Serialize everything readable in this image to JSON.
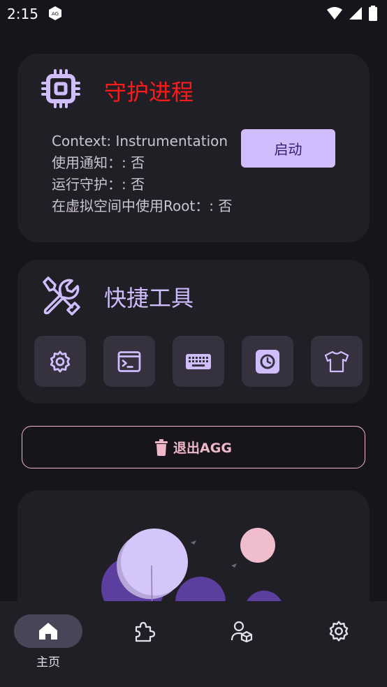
{
  "status_bar": {
    "time": "2:15"
  },
  "guard_card": {
    "title": "守护进程",
    "title_color": "#ff1a1a",
    "context_line": "Context: Instrumentation",
    "notify_line": "使用通知：: 否",
    "guard_line": "运行守护：: 否",
    "root_line": "在虚拟空间中使用Root：: 否",
    "start_button": "启动",
    "icon": "cpu-icon"
  },
  "tools_card": {
    "title": "快捷工具",
    "icon": "wrench-screwdriver-icon",
    "tools": [
      {
        "icon": "gear-icon"
      },
      {
        "icon": "terminal-icon"
      },
      {
        "icon": "keyboard-icon"
      },
      {
        "icon": "clock-app-icon"
      },
      {
        "icon": "shirt-icon"
      }
    ]
  },
  "exit_button": {
    "label": "退出AGG",
    "icon": "trash-icon",
    "color": "#efb8c8"
  },
  "bottom_nav": {
    "items": [
      {
        "label": "主页",
        "icon": "home-icon",
        "active": true
      },
      {
        "icon": "puzzle-icon"
      },
      {
        "icon": "user-cube-icon"
      },
      {
        "icon": "gear-icon"
      }
    ]
  },
  "colors": {
    "background": "#17151b",
    "card": "#211f26",
    "accent": "#cfbdfe",
    "tool_button": "#36313f"
  }
}
